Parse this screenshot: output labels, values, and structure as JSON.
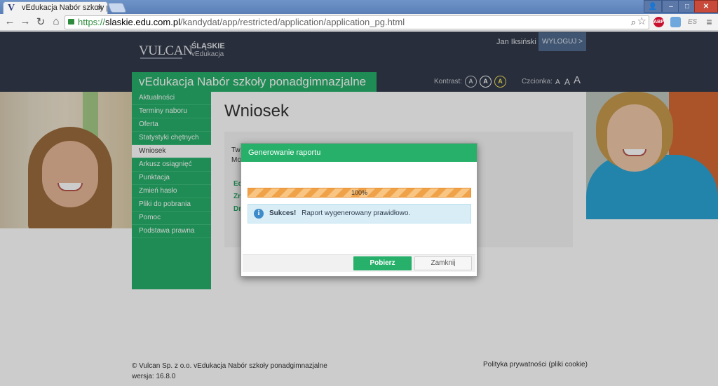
{
  "browser": {
    "tab_title": "vEdukacja Nabór szkoły p",
    "tab_favicon": "V",
    "url_scheme": "https://",
    "url_host": "slaskie.edu.com.pl",
    "url_path": "/kandydat/app/restricted/application/application_pg.html",
    "ext_abp": "ABP",
    "ext_es": "ES"
  },
  "header": {
    "logo": "VULCAN",
    "region_title": "ŚLĄSKIE",
    "region_sub": "vEdukacja",
    "username": "Jan Iksiński",
    "logout_label": "WYLOGUJ >",
    "app_title": "vEdukacja Nabór szkoły ponadgimnazjalne",
    "contrast_label": "Kontrast:",
    "contrast_options": [
      "A",
      "A",
      "A"
    ],
    "font_label": "Czcionka:",
    "font_sizes": [
      "A",
      "A",
      "A"
    ]
  },
  "sidebar": {
    "items": [
      {
        "label": "Aktualności"
      },
      {
        "label": "Terminy naboru"
      },
      {
        "label": "Oferta"
      },
      {
        "label": "Statystyki chętnych"
      },
      {
        "label": "Wniosek"
      },
      {
        "label": "Arkusz osiągnięć"
      },
      {
        "label": "Punktacja"
      },
      {
        "label": "Zmień hasło"
      },
      {
        "label": "Pliki do pobrania"
      },
      {
        "label": "Pomoc"
      },
      {
        "label": "Podstawa prawna"
      }
    ],
    "active_index": 4
  },
  "main": {
    "title": "Wniosek",
    "text_line1": "Tw",
    "text_line2": "Mo",
    "link1": "Ed",
    "link2": "Zr",
    "link3": "Dr"
  },
  "footer": {
    "copyright": "© Vulcan Sp. z o.o. vEdukacja Nabór szkoły ponadgimnazjalne wersja: 16.8.0",
    "privacy": "Polityka prywatności (pliki cookie)"
  },
  "modal": {
    "title": "Generowanie raportu",
    "progress_label": "100%",
    "progress_value": 100,
    "alert_strong": "Sukces!",
    "alert_text": "Raport wygenerowany prawidłowo.",
    "primary_button": "Pobierz",
    "secondary_button": "Zamknij"
  },
  "colors": {
    "brand_green": "#26b06a",
    "header_dark": "#323a4a",
    "progress_orange": "#f0a249",
    "alert_blue": "#d9edf7"
  }
}
